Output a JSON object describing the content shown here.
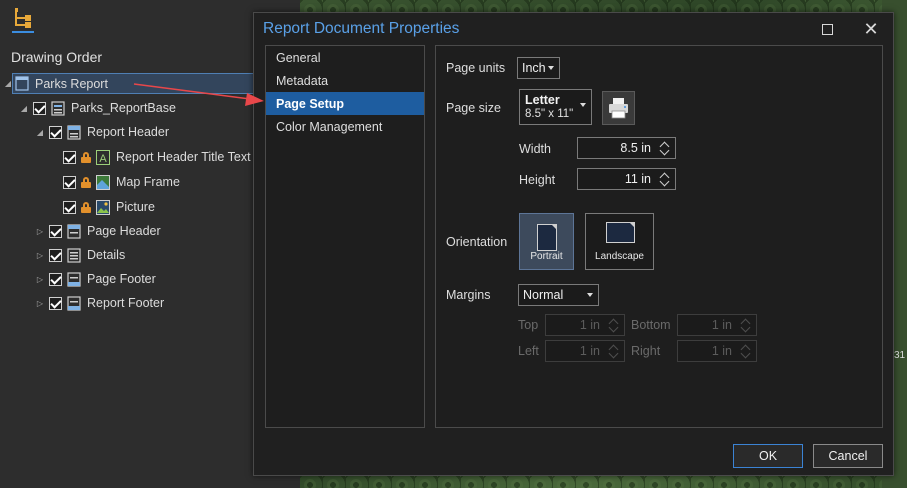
{
  "contents_pane": {
    "title": "Drawing Order",
    "tree": [
      {
        "label": "Parks Report"
      },
      {
        "label": "Parks_ReportBase"
      },
      {
        "label": "Report Header"
      },
      {
        "label": "Report Header Title Text"
      },
      {
        "label": "Map Frame"
      },
      {
        "label": "Picture"
      },
      {
        "label": "Page Header"
      },
      {
        "label": "Details"
      },
      {
        "label": "Page Footer"
      },
      {
        "label": "Report Footer"
      }
    ]
  },
  "map": {
    "edge_number": "31"
  },
  "dialog": {
    "title": "Report Document Properties",
    "nav": [
      {
        "label": "General"
      },
      {
        "label": "Metadata"
      },
      {
        "label": "Page Setup",
        "active": true
      },
      {
        "label": "Color Management"
      }
    ],
    "page_units": {
      "label": "Page units",
      "value": "Inch"
    },
    "page_size": {
      "label": "Page size",
      "name": "Letter",
      "dimensions": "8.5\" x 11\""
    },
    "width": {
      "label": "Width",
      "value": "8.5 in"
    },
    "height": {
      "label": "Height",
      "value": "11 in"
    },
    "orientation": {
      "label": "Orientation",
      "portrait": "Portrait",
      "landscape": "Landscape",
      "selected": "Portrait"
    },
    "margins": {
      "label": "Margins",
      "preset": "Normal",
      "top": {
        "label": "Top",
        "value": "1 in"
      },
      "bottom": {
        "label": "Bottom",
        "value": "1 in"
      },
      "left": {
        "label": "Left",
        "value": "1 in"
      },
      "right": {
        "label": "Right",
        "value": "1 in"
      }
    },
    "ok_label": "OK",
    "cancel_label": "Cancel"
  },
  "colors": {
    "accent": "#1e5da0",
    "title_blue": "#5aa1e8",
    "annotation_arrow": "#e8474a",
    "lock": "#e2902b"
  }
}
